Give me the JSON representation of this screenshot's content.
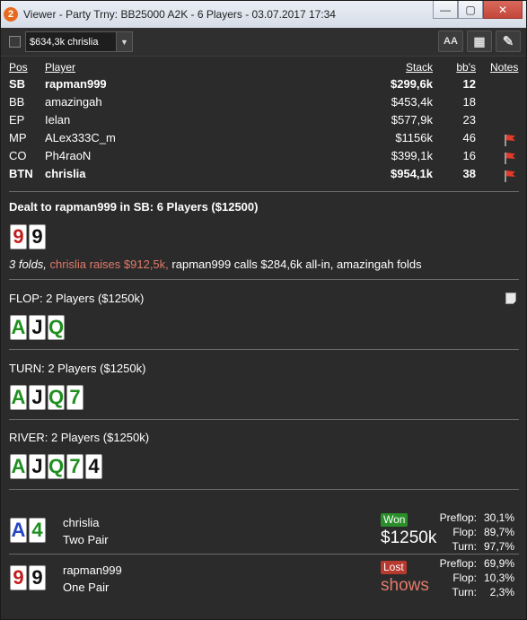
{
  "window": {
    "title": "Viewer - Party Trny: BB25000 A2K - 6 Players - 03.07.2017 17:34",
    "app_icon_text": "2",
    "minimize": "—",
    "maximize": "▢",
    "close": "✕"
  },
  "toolbar": {
    "dropdown_value": "$634,3k chrislia",
    "font_button": "AA",
    "grid_button": "▦",
    "edit_button": "✎"
  },
  "players": {
    "headers": {
      "pos": "Pos",
      "player": "Player",
      "stack": "Stack",
      "bbs": "bb's",
      "notes": "Notes"
    },
    "rows": [
      {
        "pos": "SB",
        "name": "rapman999",
        "stack": "$299,6k",
        "bbs": "12",
        "bold": true,
        "flag": false
      },
      {
        "pos": "BB",
        "name": "amazingah",
        "stack": "$453,4k",
        "bbs": "18",
        "bold": false,
        "flag": false
      },
      {
        "pos": "EP",
        "name": "Ielan",
        "stack": "$577,9k",
        "bbs": "23",
        "bold": false,
        "flag": false
      },
      {
        "pos": "MP",
        "name": "ALex333C_m",
        "stack": "$1156k",
        "bbs": "46",
        "bold": false,
        "flag": true
      },
      {
        "pos": "CO",
        "name": "Ph4raoN",
        "stack": "$399,1k",
        "bbs": "16",
        "bold": false,
        "flag": true
      },
      {
        "pos": "BTN",
        "name": "chrislia",
        "stack": "$954,1k",
        "bbs": "38",
        "bold": true,
        "flag": true
      }
    ]
  },
  "preflop": {
    "title": "Dealt to rapman999 in SB: 6 Players ($12500)",
    "cards": [
      {
        "rank": "9",
        "suit": "red"
      },
      {
        "rank": "9",
        "suit": "black"
      }
    ],
    "action_folds": "3 folds,",
    "action_raise": "chrislia raises $912,5k,",
    "action_rest": "rapman999 calls $284,6k all-in, amazingah folds"
  },
  "flop": {
    "title": "FLOP: 2 Players ($1250k)",
    "cards": [
      {
        "rank": "A",
        "suit": "green"
      },
      {
        "rank": "J",
        "suit": "black"
      },
      {
        "rank": "Q",
        "suit": "green"
      }
    ]
  },
  "turn": {
    "title": "TURN: 2 Players ($1250k)",
    "cards": [
      {
        "rank": "A",
        "suit": "green"
      },
      {
        "rank": "J",
        "suit": "black"
      },
      {
        "rank": "Q",
        "suit": "green"
      },
      {
        "rank": "7",
        "suit": "green"
      }
    ]
  },
  "river": {
    "title": "RIVER: 2 Players ($1250k)",
    "cards": [
      {
        "rank": "A",
        "suit": "green"
      },
      {
        "rank": "J",
        "suit": "black"
      },
      {
        "rank": "Q",
        "suit": "green"
      },
      {
        "rank": "7",
        "suit": "green"
      },
      {
        "rank": "4",
        "suit": "black"
      }
    ]
  },
  "results": [
    {
      "name": "chrislia",
      "hand": "Two Pair",
      "cards": [
        {
          "rank": "A",
          "suit": "blue"
        },
        {
          "rank": "4",
          "suit": "green"
        }
      ],
      "badge": "Won",
      "amount": "$1250k",
      "stats": [
        {
          "label": "Preflop:",
          "value": "30,1%"
        },
        {
          "label": "Flop:",
          "value": "89,7%"
        },
        {
          "label": "Turn:",
          "value": "97,7%"
        }
      ]
    },
    {
      "name": "rapman999",
      "hand": "One Pair",
      "cards": [
        {
          "rank": "9",
          "suit": "red"
        },
        {
          "rank": "9",
          "suit": "black"
        }
      ],
      "badge": "Lost",
      "amount": "shows",
      "stats": [
        {
          "label": "Preflop:",
          "value": "69,9%"
        },
        {
          "label": "Flop:",
          "value": "10,3%"
        },
        {
          "label": "Turn:",
          "value": "2,3%"
        }
      ]
    }
  ]
}
